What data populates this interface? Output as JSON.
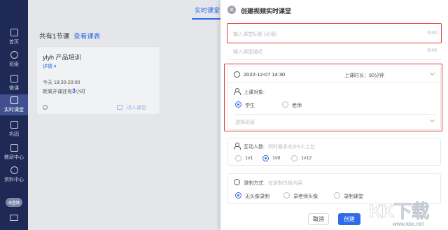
{
  "sidebar": {
    "items": [
      {
        "label": "首页",
        "icon": "home-icon"
      },
      {
        "label": "班级",
        "icon": "users-icon"
      },
      {
        "label": "微课",
        "icon": "video-icon"
      },
      {
        "label": "实时课堂",
        "icon": "live-class-icon",
        "active": true
      },
      {
        "label": "巩固",
        "icon": "practice-icon"
      },
      {
        "label": "教研中心",
        "icon": "research-icon"
      },
      {
        "label": "资料中心",
        "icon": "library-icon"
      }
    ],
    "avatar_text": "未登陆"
  },
  "page": {
    "tab": "实时课堂",
    "heading": "共有1节课",
    "view_link": "查看课表",
    "course": {
      "title": "ylyh 产品培训",
      "detail_link": "详情",
      "time": "今天 18:30-20:00",
      "countdown_prefix": "距离开课还有",
      "countdown_value": "3",
      "countdown_suffix": "小时",
      "enter_label": "进入课堂"
    }
  },
  "dialog": {
    "title": "创建视频实时课堂",
    "course_title": {
      "placeholder": "输入课堂标题 (必填)",
      "count": "0/40"
    },
    "course_desc": {
      "placeholder": "输入课堂描述",
      "count": "0/40"
    },
    "datetime": "2022-12-07 14:30",
    "duration": "上课时长：90分钟",
    "audience": {
      "label": "上课对象:",
      "options": [
        "学生",
        "老师"
      ],
      "selected": "学生",
      "class_placeholder": "选择班级"
    },
    "interactive": {
      "label": "互动人数:",
      "hint": "同时最多允许6人上台",
      "options": [
        "1v1",
        "1v6",
        "1v12"
      ],
      "selected": "1v6"
    },
    "recording": {
      "label": "录制方式:",
      "hint": "仅录制白板内容",
      "options": [
        "无头像录制",
        "录老师头像",
        "录制课堂"
      ],
      "selected": "无头像录制"
    },
    "buttons": {
      "cancel": "取消",
      "create": "创建"
    }
  },
  "watermark": {
    "logo": "KK下载",
    "url": "www.kkx.net"
  },
  "colors": {
    "accent": "#2f6ae8",
    "sidebar": "#1e2a55",
    "highlight": "#e23b3b"
  }
}
